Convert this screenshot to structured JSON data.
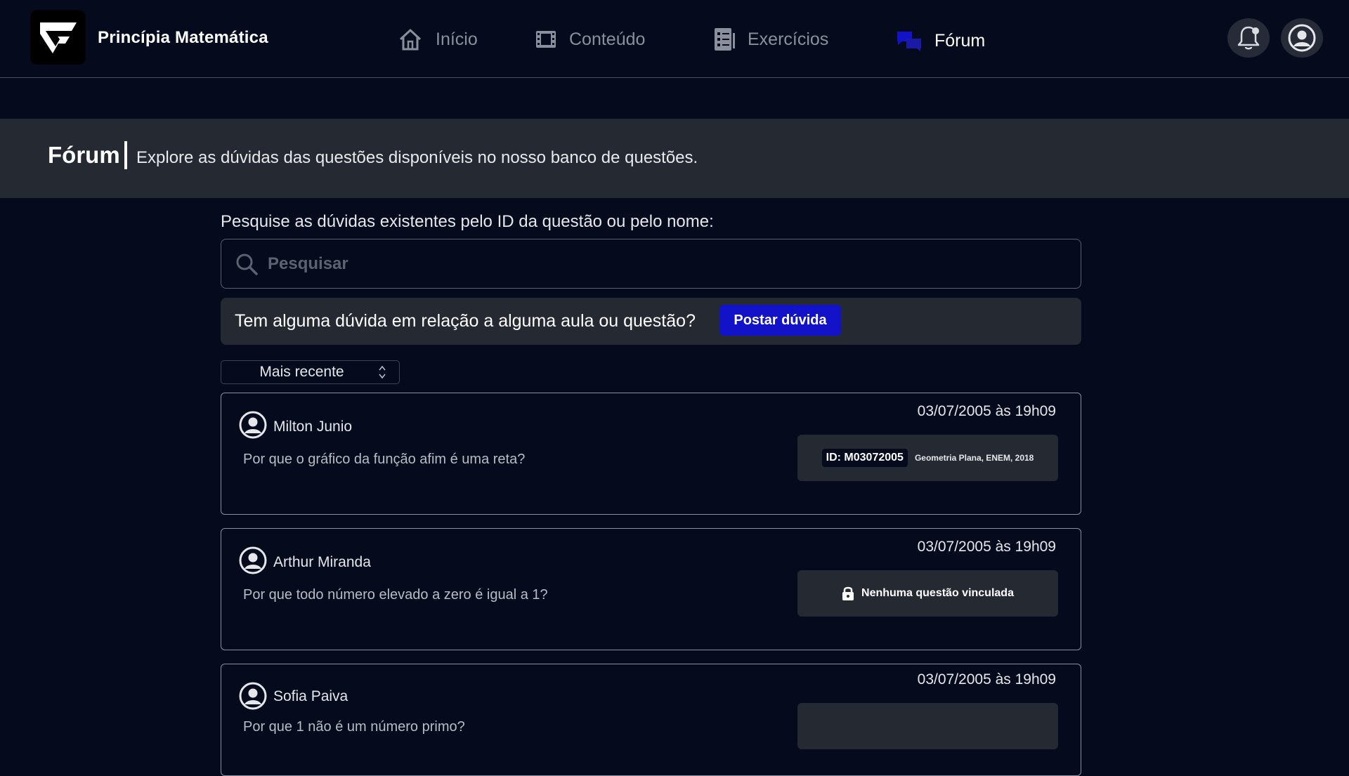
{
  "app": {
    "title": "Princípia Matemática"
  },
  "nav": {
    "items": [
      {
        "label": "Início",
        "icon": "home-icon",
        "active": false
      },
      {
        "label": "Conteúdo",
        "icon": "film-icon",
        "active": false
      },
      {
        "label": "Exercícios",
        "icon": "checklist-icon",
        "active": false
      },
      {
        "label": "Fórum",
        "icon": "chat-bubbles-icon",
        "active": true
      }
    ],
    "notifications_icon": "bell-icon",
    "profile_icon": "user-circle-icon"
  },
  "banner": {
    "title": "Fórum",
    "subtitle": "Explore as dúvidas das questões disponíveis no nosso banco de questões."
  },
  "search": {
    "label": "Pesquise as dúvidas existentes pelo ID da questão ou pelo nome:",
    "placeholder": "Pesquisar",
    "value": ""
  },
  "ask": {
    "text": "Tem alguma dúvida em relação a alguma aula ou questão?",
    "button_label": "Postar dúvida"
  },
  "sort": {
    "selected": "Mais recente"
  },
  "posts": [
    {
      "author": "Milton Junio",
      "date": "03/07/2005 às 19h09",
      "question": "Por que o gráfico da função afim é uma reta?",
      "tag_id": "ID: M03072005",
      "tag_meta": "Geometria Plana, ENEM, 2018"
    },
    {
      "author": "Arthur Miranda",
      "date": "03/07/2005 às 19h09",
      "question": "Por que todo número elevado a zero é igual a 1?",
      "tag_none": "Nenhuma questão vinculada"
    },
    {
      "author": "Sofia Paiva",
      "date": "03/07/2005 às 19h09",
      "question": "Por que 1 não é um número primo?"
    }
  ],
  "colors": {
    "background": "#050b1c",
    "panel": "#252932",
    "accent": "#1212c9",
    "muted_text": "#8b8f9b"
  }
}
